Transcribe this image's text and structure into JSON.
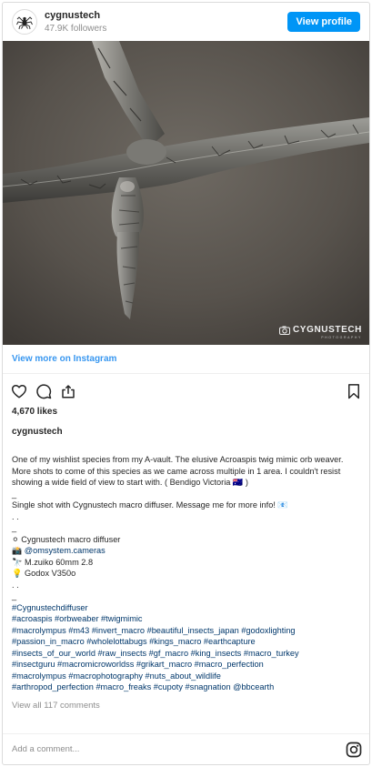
{
  "header": {
    "username": "cygnustech",
    "followers": "47.9K followers",
    "view_profile_label": "View profile"
  },
  "photo": {
    "watermark_main": "CYGNUSTECH",
    "watermark_sub": "PHOTOGRAPHY"
  },
  "view_more_label": "View more on Instagram",
  "likes": "4,670 likes",
  "post_username": "cygnustech",
  "caption": {
    "line1": "One of my wishlist species from my A-vault. The elusive Acroaspis twig mimic orb weaver. More shots to come of this species as we came across multiple in 1 area. I couldn't resist showing a wide field of view to start with. ( Bendigo Victoria 🇦🇺 )",
    "sep1": "_",
    "line2": "Single shot with Cygnustech macro diffuser. Message me for more info! 📧",
    "dots1": ". .",
    "sep2": "_",
    "gear1": "⚪ Cygnustech macro diffuser",
    "gear2_emoji": "📸",
    "gear2_tag": "@omsystem.cameras",
    "gear3": "🔭 M.zuiko 60mm 2.8",
    "gear4": "💡 Godox V350o",
    "dots2": ". .",
    "sep3": "_",
    "hashtags": "#Cygnustechdiffuser\n#acroaspis #orbweaber #twigmimic\n#macrolympus #m43 #invert_macro #beautiful_insects_japan #godoxlighting\n#passion_in_macro #wholelottabugs #kings_macro #earthcapture\n#insects_of_our_world #raw_insects #gf_macro #king_insects #macro_turkey\n#insectguru #macromicroworldss #grikart_macro #macro_perfection\n#macrolympus #macrophotography #nuts_about_wildlife\n#arthropod_perfection #macro_freaks #cupoty #snagnation @bbcearth"
  },
  "view_all_comments": "View all 117 comments",
  "add_comment_placeholder": "Add a comment...",
  "colors": {
    "accent": "#0095f6",
    "link": "#3897f0",
    "hashtag": "#00376b",
    "muted": "#8e8e8e"
  },
  "icons": {
    "like": "heart-icon",
    "comment": "comment-icon",
    "share": "share-icon",
    "save": "bookmark-icon",
    "instagram": "instagram-icon",
    "avatar": "spider-avatar-icon"
  }
}
